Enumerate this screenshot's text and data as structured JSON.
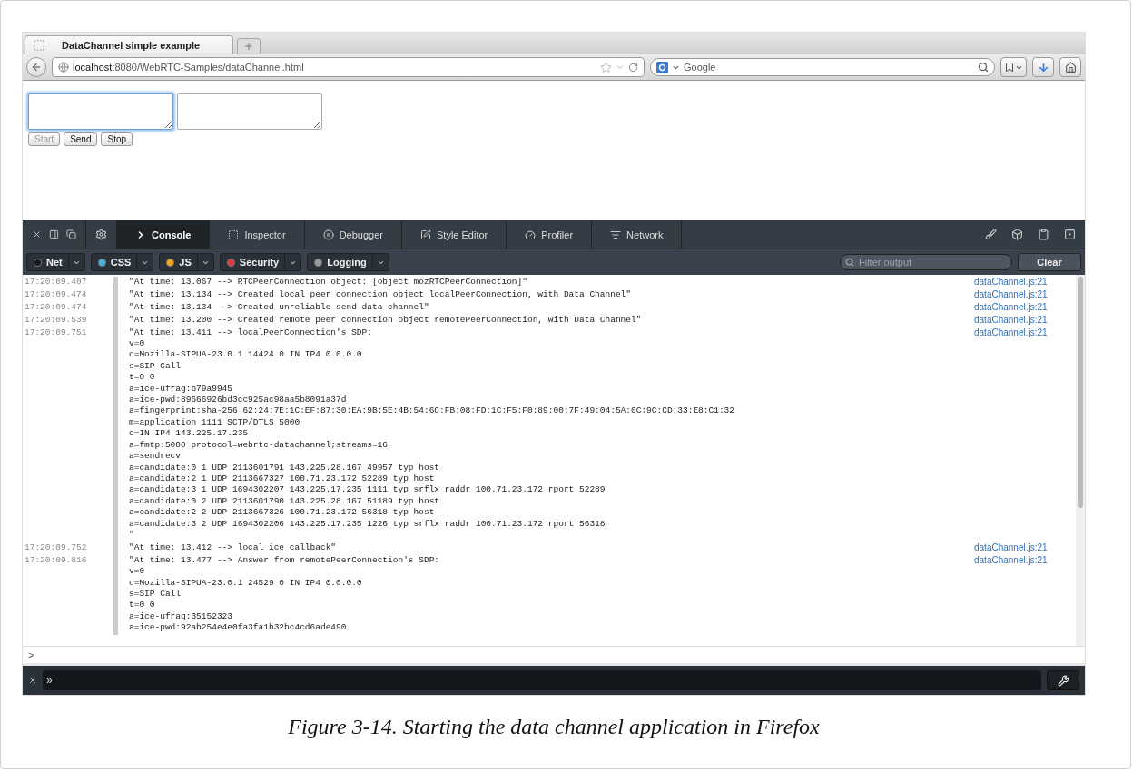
{
  "browser": {
    "tab": {
      "title": "DataChannel simple example",
      "selected": true
    },
    "url": {
      "host": "localhost",
      "path": ":8080/WebRTC-Samples/dataChannel.html"
    },
    "search": {
      "engine": "Google"
    }
  },
  "page": {
    "fields": [
      {
        "focused": true
      },
      {
        "focused": false
      }
    ],
    "buttons": [
      {
        "label": "Start",
        "disabled": true
      },
      {
        "label": "Send",
        "disabled": false
      },
      {
        "label": "Stop",
        "disabled": false
      }
    ]
  },
  "devtools": {
    "tabs": [
      {
        "label": "Console",
        "kind": "console",
        "selected": true
      },
      {
        "label": "Inspector",
        "kind": "inspector",
        "selected": false
      },
      {
        "label": "Debugger",
        "kind": "debugger",
        "selected": false
      },
      {
        "label": "Style Editor",
        "kind": "style",
        "selected": false
      },
      {
        "label": "Profiler",
        "kind": "profiler",
        "selected": false
      },
      {
        "label": "Network",
        "kind": "network",
        "selected": false
      }
    ],
    "filters": [
      {
        "label": "Net",
        "color": "#1a1a1a"
      },
      {
        "label": "CSS",
        "color": "#3fb3e8"
      },
      {
        "label": "JS",
        "color": "#f5a623"
      },
      {
        "label": "Security",
        "color": "#e8323c"
      },
      {
        "label": "Logging",
        "color": "#9a9a9a"
      }
    ],
    "filter_placeholder": "Filter output",
    "clear": "Clear",
    "log": [
      {
        "time": "17:20:09.407",
        "source": "dataChannel.js:21",
        "lines": [
          "\"At time: 13.067 --> RTCPeerConnection object: [object mozRTCPeerConnection]\""
        ]
      },
      {
        "time": "17:20:09.474",
        "source": "dataChannel.js:21",
        "lines": [
          "\"At time: 13.134 --> Created local peer connection object localPeerConnection, with Data Channel\""
        ]
      },
      {
        "time": "17:20:09.474",
        "source": "dataChannel.js:21",
        "lines": [
          "\"At time: 13.134 --> Created unreliable send data channel\""
        ]
      },
      {
        "time": "17:20:09.539",
        "source": "dataChannel.js:21",
        "lines": [
          "\"At time: 13.200 --> Created remote peer connection object remotePeerConnection, with Data Channel\""
        ]
      },
      {
        "time": "17:20:09.751",
        "source": "dataChannel.js:21",
        "lines": [
          "\"At time: 13.411 --> localPeerConnection's SDP:",
          "v=0",
          "o=Mozilla-SIPUA-23.0.1 14424 0 IN IP4 0.0.0.0",
          "s=SIP Call",
          "t=0 0",
          "a=ice-ufrag:b79a9945",
          "a=ice-pwd:89666926bd3cc925ac98aa5b8091a37d",
          "a=fingerprint:sha-256 62:24:7E:1C:EF:87:30:EA:9B:5E:4B:54:6C:FB:08:FD:1C:F5:F0:89:00:7F:49:04:5A:0C:9C:CD:33:E8:C1:32",
          "m=application 1111 SCTP/DTLS 5000",
          "c=IN IP4 143.225.17.235",
          "a=fmtp:5000 protocol=webrtc-datachannel;streams=16",
          "a=sendrecv",
          "a=candidate:0 1 UDP 2113601791 143.225.28.167 49957 typ host",
          "a=candidate:2 1 UDP 2113667327 100.71.23.172 52289 typ host",
          "a=candidate:3 1 UDP 1694302207 143.225.17.235 1111 typ srflx raddr 100.71.23.172 rport 52289",
          "a=candidate:0 2 UDP 2113601790 143.225.28.167 51189 typ host",
          "a=candidate:2 2 UDP 2113667326 100.71.23.172 56318 typ host",
          "a=candidate:3 2 UDP 1694302206 143.225.17.235 1226 typ srflx raddr 100.71.23.172 rport 56318",
          "\""
        ]
      },
      {
        "time": "17:20:09.752",
        "source": "dataChannel.js:21",
        "lines": [
          "\"At time: 13.412 --> local ice callback\""
        ]
      },
      {
        "time": "17:20:09.816",
        "source": "dataChannel.js:21",
        "lines": [
          "\"At time: 13.477 --> Answer from remotePeerConnection's SDP:",
          "v=0",
          "o=Mozilla-SIPUA-23.0.1 24529 0 IN IP4 0.0.0.0",
          "s=SIP Call",
          "t=0 0",
          "a=ice-ufrag:35152323",
          "a=ice-pwd:92ab254e4e0fa3fa1b32bc4cd6ade490"
        ]
      }
    ],
    "prompt": ">",
    "command_prompt": "»"
  },
  "caption": "Figure 3-14. Starting the data channel application in Firefox"
}
